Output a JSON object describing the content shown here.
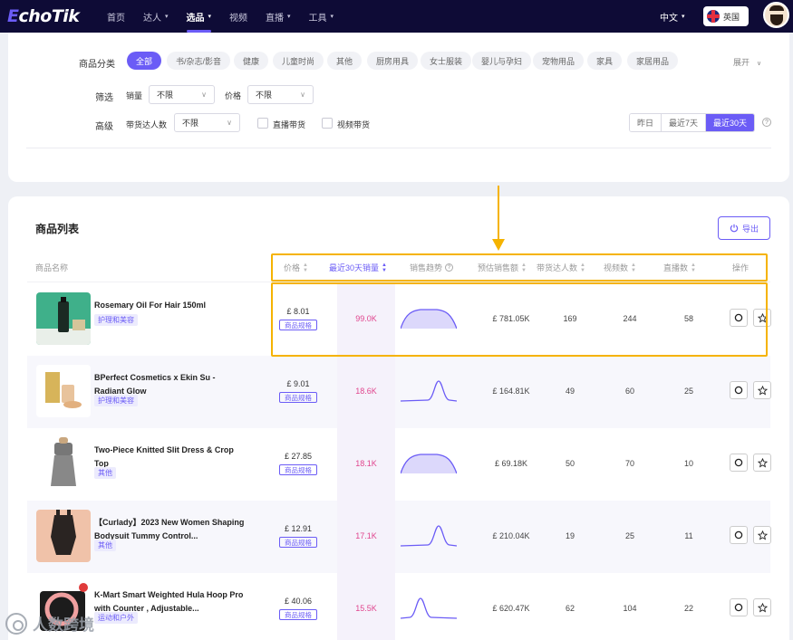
{
  "nav": {
    "logo_e": "E",
    "logo_rest": "choTik",
    "items": [
      {
        "label": "首页",
        "caret": ""
      },
      {
        "label": "达人",
        "caret": "▾"
      },
      {
        "label": "选品",
        "caret": "▾"
      },
      {
        "label": "视频",
        "caret": ""
      },
      {
        "label": "直播",
        "caret": "▾"
      },
      {
        "label": "工具",
        "caret": "▾"
      }
    ],
    "active_index": 2,
    "language": "中文",
    "language_caret": "▾",
    "region": "英国"
  },
  "filters": {
    "category_label": "商品分类",
    "categories": [
      "全部",
      "书/杂志/影音",
      "健康",
      "儿童时尚",
      "其他",
      "厨房用具",
      "女士服装",
      "婴儿与孕妇",
      "宠物用品",
      "家具",
      "家居用品"
    ],
    "expand_label": "展开",
    "filter_label": "筛选",
    "sales_label": "销量",
    "sales_value": "不限",
    "price_label": "价格",
    "price_value": "不限",
    "advanced_label": "高级",
    "creators_label": "带货达人数",
    "creators_value": "不限",
    "live_label": "直播带货",
    "video_label": "视频带货",
    "periods": [
      "昨日",
      "最近7天",
      "最近30天"
    ],
    "active_period": 2,
    "help": "?"
  },
  "list": {
    "title": "商品列表",
    "export_label": "导出",
    "headers": {
      "name": "商品名称",
      "price": "价格",
      "sales30": "最近30天销量",
      "trend": "销售趋势",
      "revenue": "预估销售额",
      "creators": "带货达人数",
      "videos": "视频数",
      "lives": "直播数",
      "actions": "操作"
    },
    "spec_label": "商品规格",
    "products": [
      {
        "name": "Rosemary Oil For Hair 150ml",
        "tag": "护理和美容",
        "price": "£ 8.01",
        "sales": "99.0K",
        "revenue": "£ 781.05K",
        "creators": "169",
        "videos": "244",
        "lives": "58",
        "trend": "plateau"
      },
      {
        "name": "BPerfect Cosmetics x Ekin Su - Radiant Glow",
        "tag": "护理和美容",
        "price": "£ 9.01",
        "sales": "18.6K",
        "revenue": "£ 164.81K",
        "creators": "49",
        "videos": "60",
        "lives": "25",
        "trend": "spike"
      },
      {
        "name": "Two-Piece Knitted Slit Dress & Crop Top",
        "tag": "其他",
        "price": "£ 27.85",
        "sales": "18.1K",
        "revenue": "£ 69.18K",
        "creators": "50",
        "videos": "70",
        "lives": "10",
        "trend": "plateau"
      },
      {
        "name": "【Curlady】2023 New Women Shaping Bodysuit Tummy Control...",
        "tag": "其他",
        "price": "£ 12.91",
        "sales": "17.1K",
        "revenue": "£ 210.04K",
        "creators": "19",
        "videos": "25",
        "lives": "11",
        "trend": "spike"
      },
      {
        "name": "K-Mart Smart Weighted Hula Hoop Pro with Counter , Adjustable...",
        "tag": "运动和户外",
        "price": "£ 40.06",
        "sales": "15.5K",
        "revenue": "£ 620.47K",
        "creators": "62",
        "videos": "104",
        "lives": "22",
        "trend": "spike_early"
      }
    ]
  },
  "colors": {
    "accent": "#6b5cf6",
    "highlight": "#f5b300",
    "sales": "#e0468e",
    "nav_bg": "#0e0b36"
  },
  "watermark": "人数跨境"
}
